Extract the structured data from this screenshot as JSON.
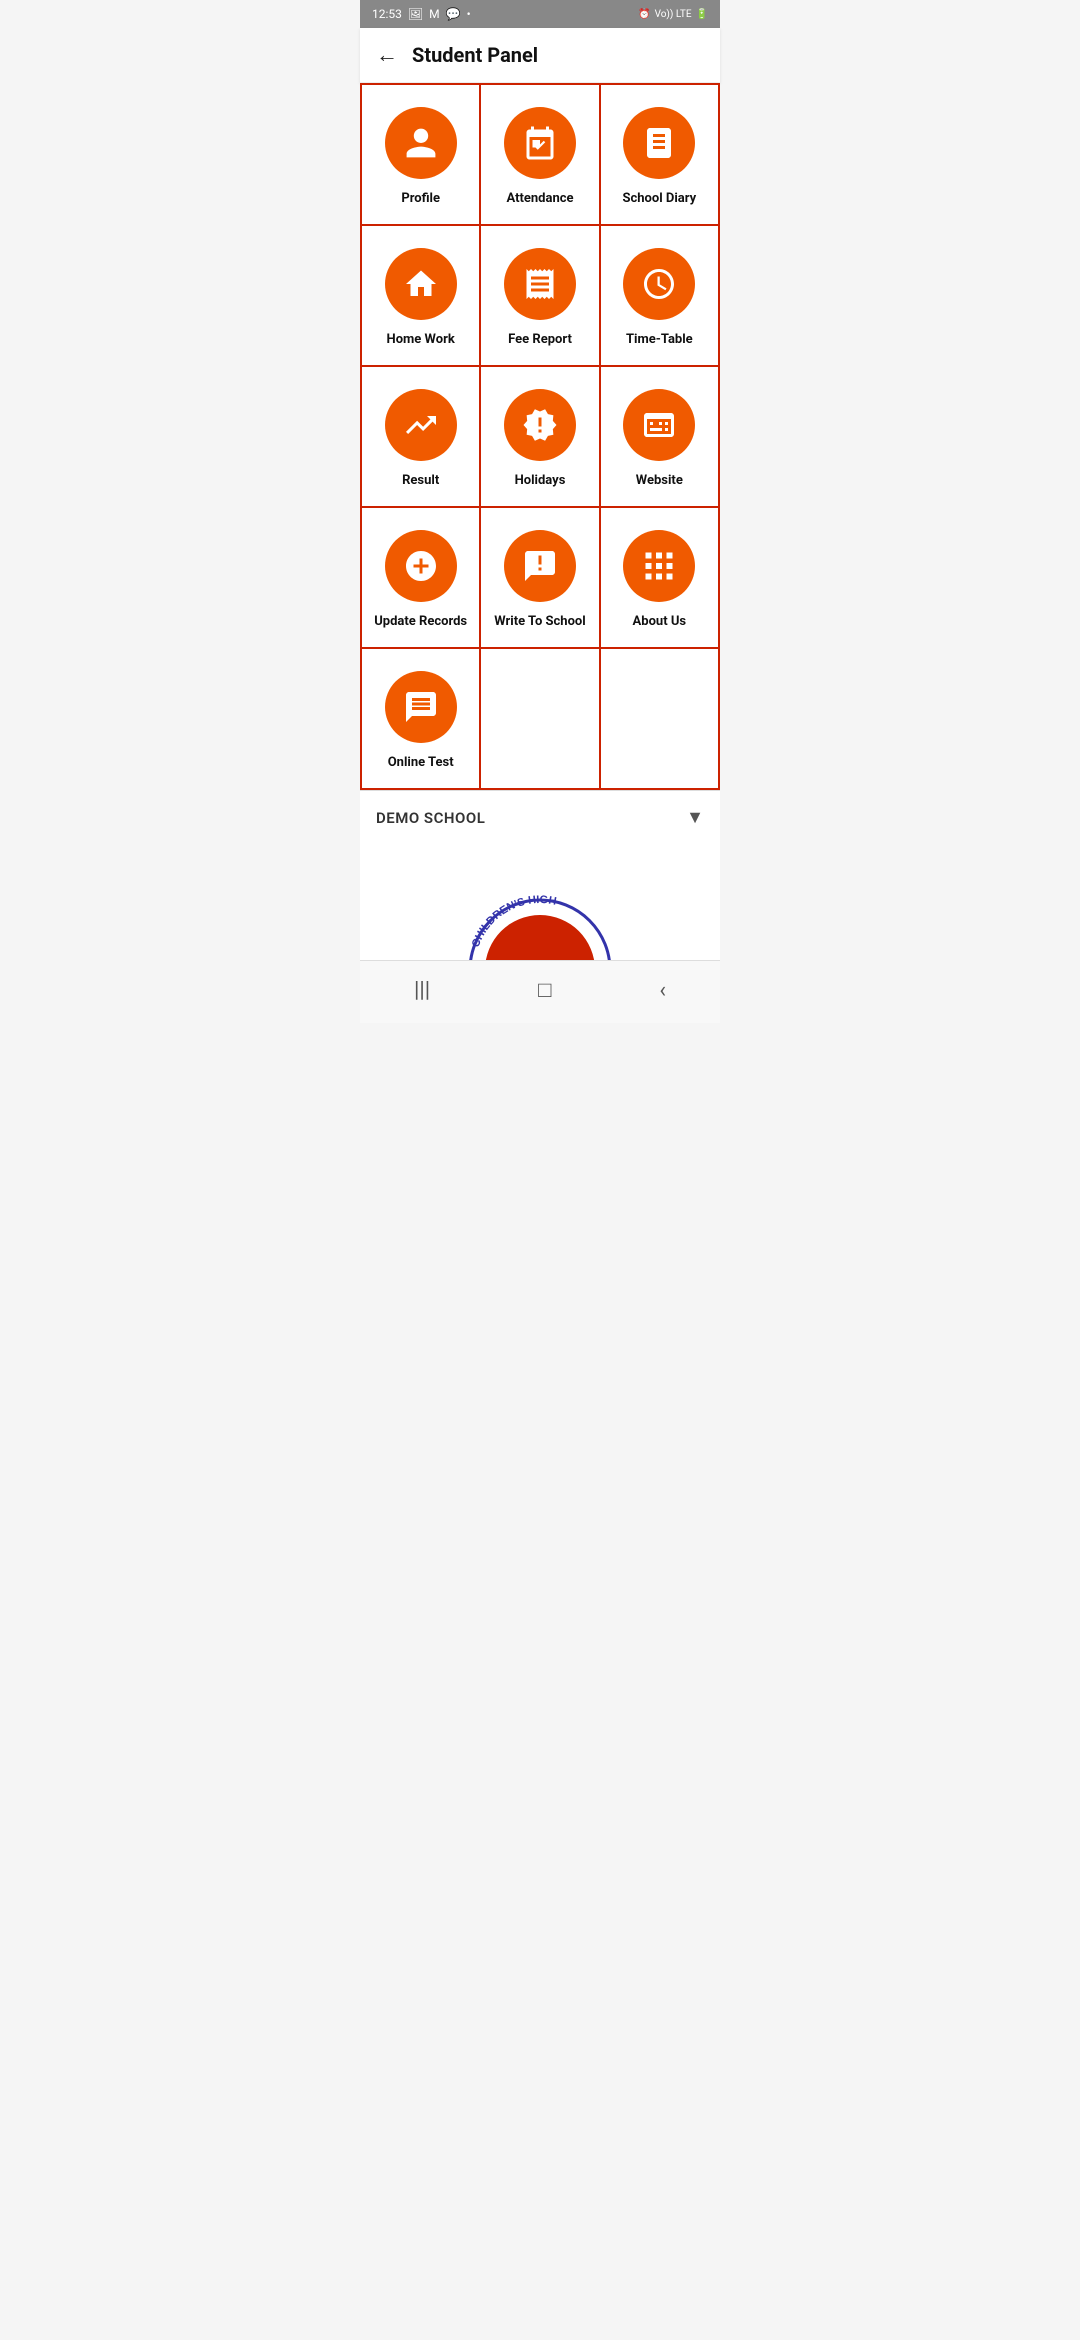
{
  "statusBar": {
    "time": "12:53",
    "rightIcons": "Vo)) LTE↑↓ 🔋"
  },
  "header": {
    "backLabel": "←",
    "title": "Student Panel"
  },
  "grid": {
    "items": [
      {
        "id": "profile",
        "label": "Profile",
        "icon": "person"
      },
      {
        "id": "attendance",
        "label": "Attendance",
        "icon": "calendar-check"
      },
      {
        "id": "school-diary",
        "label": "School Diary",
        "icon": "book"
      },
      {
        "id": "home-work",
        "label": "Home Work",
        "icon": "home"
      },
      {
        "id": "fee-report",
        "label": "Fee Report",
        "icon": "receipt"
      },
      {
        "id": "time-table",
        "label": "Time-Table",
        "icon": "clock"
      },
      {
        "id": "result",
        "label": "Result",
        "icon": "trend-up"
      },
      {
        "id": "holidays",
        "label": "Holidays",
        "icon": "umbrella"
      },
      {
        "id": "website",
        "label": "Website",
        "icon": "browser"
      },
      {
        "id": "update-records",
        "label": "Update Records",
        "icon": "plus-circle"
      },
      {
        "id": "write-to-school",
        "label": "Write To School",
        "icon": "chat-alert"
      },
      {
        "id": "about-us",
        "label": "About Us",
        "icon": "grid"
      },
      {
        "id": "online-test",
        "label": "Online Test",
        "icon": "chat-bubble"
      },
      {
        "id": "empty1",
        "label": "",
        "icon": ""
      },
      {
        "id": "empty2",
        "label": "",
        "icon": ""
      }
    ]
  },
  "footer": {
    "schoolName": "DEMO SCHOOL",
    "dropdownArrow": "▼"
  },
  "logo": {
    "text": "CHILDREN'S HIGH"
  },
  "navBar": {
    "items": [
      "|||",
      "□",
      "<"
    ]
  }
}
